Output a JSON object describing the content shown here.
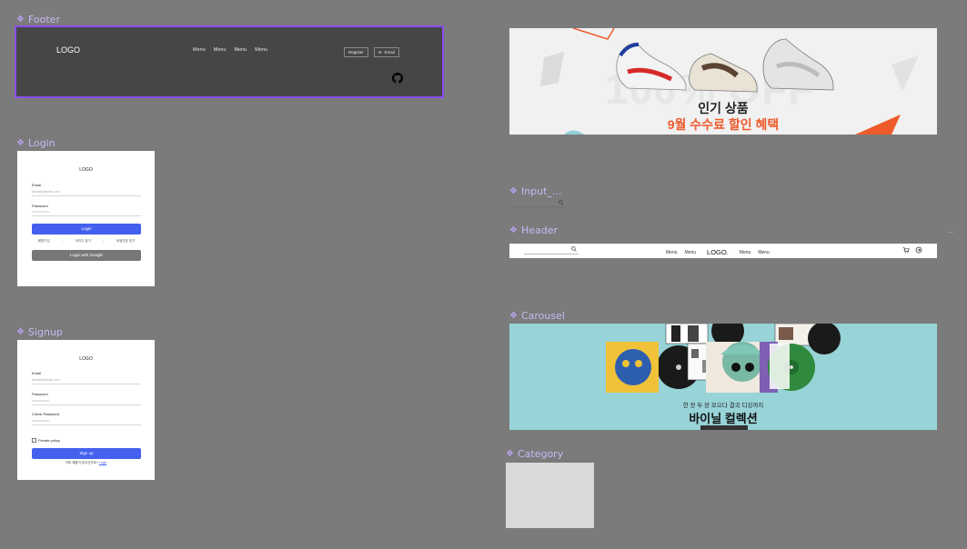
{
  "labels": {
    "footer": "Footer",
    "login": "Login",
    "signup": "Signup",
    "input": "Input_...",
    "header": "Header",
    "carousel": "Carousel",
    "category": "Category"
  },
  "footer": {
    "logo": "LOGO",
    "menu": [
      "Menu",
      "Menu",
      "Menu",
      "Menu"
    ],
    "register": "Register",
    "email": "Email"
  },
  "login": {
    "logo": "LOGO",
    "email_label": "Email",
    "email_placeholder": "jamesk@gmail.com",
    "password_label": "Password",
    "password_placeholder": "••••••••••••••••",
    "login_button": "Login",
    "links": [
      "회원가입",
      "아이디 찾기",
      "비밀번호 찾기"
    ],
    "google_button": "Login with Google"
  },
  "signup": {
    "logo": "LOGO",
    "email_label": "Email",
    "email_placeholder": "jamesk@gmail.com",
    "password_label": "Password",
    "password_placeholder": "••••••••••••••••",
    "check_label": "Check Password",
    "check_placeholder": "••••••••••••••••",
    "privacy": "Private policy",
    "signup_button": "Sign up",
    "login_prompt": "이미 계정이 있으신가요?",
    "login_link": "Login"
  },
  "banner": {
    "bg_text": "100% OFF",
    "title": "인기 상품",
    "subtitle": "9월 수수료 할인 혜택"
  },
  "header": {
    "logo": "LOGO.",
    "menu_left": [
      "Menu",
      "Menu"
    ],
    "menu_right": [
      "Menu",
      "Menu"
    ]
  },
  "carousel": {
    "title": "한 장 두 장 모으다 결국 디깅까지",
    "subtitle": "바이닐 컬렉션"
  },
  "colors": {
    "canvas": "#7b7b7b",
    "accent": "#4361ee",
    "selection": "#8b4cf0",
    "banner_accent": "#ee5a2a",
    "carousel_bg": "#97d3d7"
  }
}
